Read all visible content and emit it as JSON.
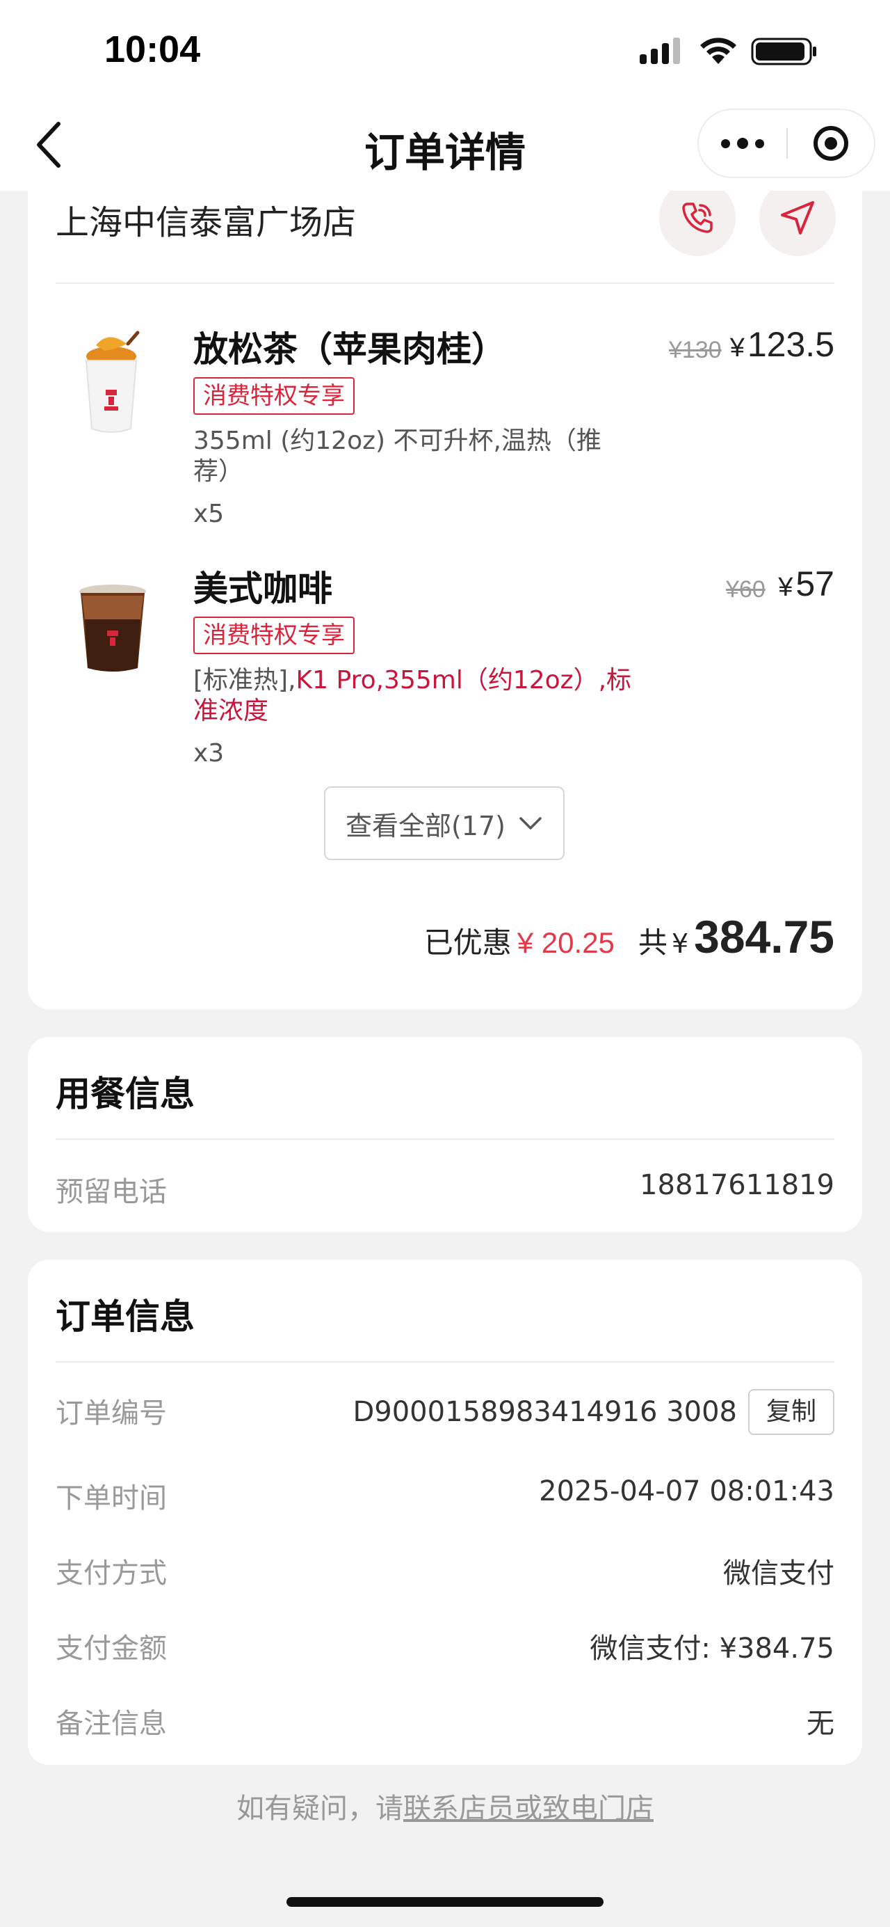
{
  "status_bar": {
    "time": "10:04"
  },
  "nav": {
    "title": "订单详情"
  },
  "store": {
    "name": "上海中信泰富广场店"
  },
  "items": [
    {
      "name": "放松茶（苹果肉桂）",
      "tag": "消费特权专享",
      "spec": "355ml (约12oz) 不可升杯,温热（推荐）",
      "qty": "x5",
      "price_old": "¥130",
      "price_yen": "¥",
      "price": "123.5"
    },
    {
      "name": "美式咖啡",
      "tag": "消费特权专享",
      "spec_gray": "[标准热],",
      "spec_red": "K1 Pro,355ml（约12oz）,标准浓度",
      "qty": "x3",
      "price_old": "¥60",
      "price_yen": "¥",
      "price": "57"
    }
  ],
  "view_all": "查看全部(17)",
  "summary": {
    "discount_label": "已优惠",
    "discount": "¥ 20.25",
    "total_label": "共",
    "yen": "¥",
    "total": "384.75"
  },
  "dining": {
    "title": "用餐信息",
    "phone_label": "预留电话",
    "phone": "18817611819"
  },
  "order": {
    "title": "订单信息",
    "rows": [
      {
        "label": "订单编号",
        "value": "D9000158983414916 3008"
      },
      {
        "label": "下单时间",
        "value": "2025-04-07 08:01:43"
      },
      {
        "label": "支付方式",
        "value": "微信支付"
      },
      {
        "label": "支付金额",
        "value": "微信支付: ¥384.75"
      },
      {
        "label": "备注信息",
        "value": "无"
      }
    ],
    "copy_label": "复制"
  },
  "footer": {
    "prefix": "如有疑问，请",
    "link": "联系店员或致电门店"
  },
  "colors": {
    "accent": "#d9253b",
    "discount": "#e23a4a",
    "spec_red": "#c8163b"
  }
}
